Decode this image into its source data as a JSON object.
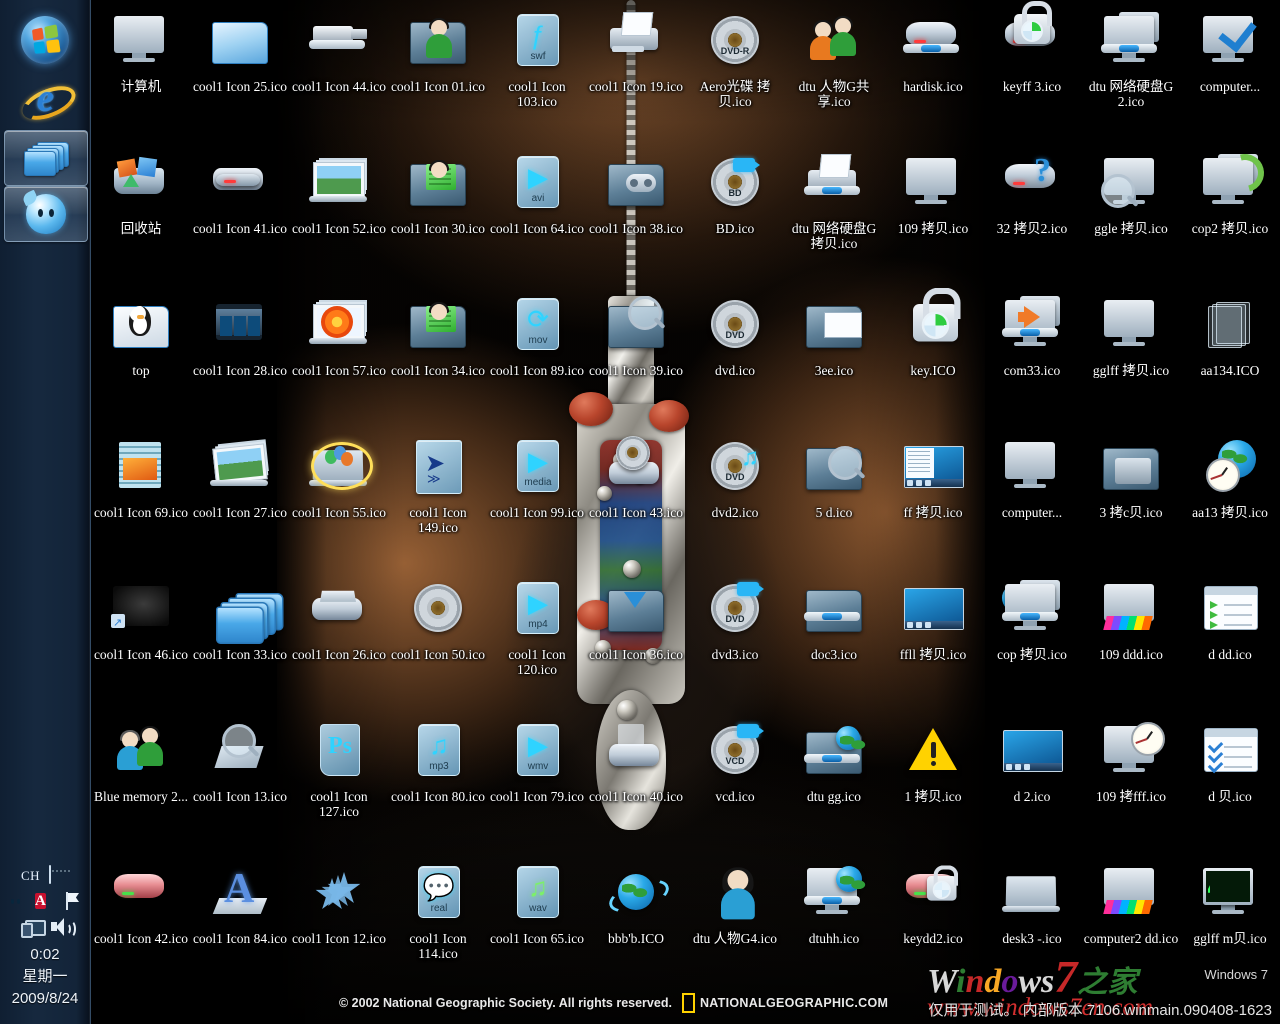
{
  "taskbar": {
    "start_button": "Start",
    "launchers": [
      {
        "name": "internet-explorer",
        "label": "Internet Explorer"
      },
      {
        "name": "windows-explorer",
        "label": "Windows Explorer"
      },
      {
        "name": "qq-messenger",
        "label": "QQ"
      }
    ],
    "tray": {
      "language": "CH",
      "keyboard": "keyboard-icon",
      "icons": [
        "qq-tray-icon",
        "avira-antivirus-icon",
        "action-flag-icon",
        "network-icon",
        "volume-icon"
      ],
      "clock_time": "0:02",
      "clock_weekday": "星期一",
      "clock_date": "2009/8/24"
    }
  },
  "watermark": {
    "brand_w": "W",
    "brand_i": "i",
    "brand_n": "n",
    "brand_d": "d",
    "brand_o": "o",
    "brand_ws": "ws",
    "brand_seven": "7",
    "brand_cn": "之家",
    "url": "www.windows7en.com",
    "product": "Windows 7",
    "build_notice": "仅用于测试。  内部版本 7106.winmain.090408-1623"
  },
  "wallpaper_credit": {
    "copyright": "© 2002 National Geographic Society. All rights reserved.",
    "brand": "NATIONALGEOGRAPHIC.COM"
  },
  "icons": [
    {
      "label": "计算机",
      "art": "computer"
    },
    {
      "label": "cool1 Icon 25.ico",
      "art": "folder-blue"
    },
    {
      "label": "cool1 Icon 44.ico",
      "art": "usb-drive"
    },
    {
      "label": "cool1 Icon 01.ico",
      "art": "person-green"
    },
    {
      "label": "cool1 Icon 103.ico",
      "art": "file-swf"
    },
    {
      "label": "cool1 Icon 19.ico",
      "art": "printer"
    },
    {
      "label": "Aero光碟 拷贝.ico",
      "art": "disc-dvdr"
    },
    {
      "label": "dtu 人物G共享.ico",
      "art": "two-people"
    },
    {
      "label": "hardisk.ico",
      "art": "harddisk"
    },
    {
      "label": "keyff 3.ico",
      "art": "disk-lock"
    },
    {
      "label": "dtu 网络硬盘G 2.ico",
      "art": "network-drive"
    },
    {
      "label": "computer...",
      "art": "monitor-check"
    },
    {
      "label": "回收站",
      "art": "recycle-bin"
    },
    {
      "label": "cool1 Icon 41.ico",
      "art": "scanner"
    },
    {
      "label": "cool1 Icon 52.ico",
      "art": "photo-laptop"
    },
    {
      "label": "cool1 Icon 30.ico",
      "art": "person-doc"
    },
    {
      "label": "cool1 Icon 64.ico",
      "art": "file-avi"
    },
    {
      "label": "cool1 Icon 38.ico",
      "art": "folder-game"
    },
    {
      "label": "BD.ico",
      "art": "disc-bd"
    },
    {
      "label": "dtu 网络硬盘G 拷贝.ico",
      "art": "printer-blue"
    },
    {
      "label": "109 拷贝.ico",
      "art": "monitor-plain"
    },
    {
      "label": "32 拷贝2.ico",
      "art": "disk-question"
    },
    {
      "label": "ggle 拷贝.ico",
      "art": "monitor-search"
    },
    {
      "label": "cop2 拷贝.ico",
      "art": "monitor-refresh"
    },
    {
      "label": "top",
      "art": "folder-penguin"
    },
    {
      "label": "cool1 Icon 28.ico",
      "art": "filmstrip"
    },
    {
      "label": "cool1 Icon 57.ico",
      "art": "photos-flower"
    },
    {
      "label": "cool1 Icon 34.ico",
      "art": "person-greendoc"
    },
    {
      "label": "cool1 Icon 89.ico",
      "art": "file-mov"
    },
    {
      "label": "cool1 Icon 39.ico",
      "art": "folder-search"
    },
    {
      "label": "dvd.ico",
      "art": "disc-dvd"
    },
    {
      "label": "3ee.ico",
      "art": "folder-mail"
    },
    {
      "label": "key.ICO",
      "art": "padlock"
    },
    {
      "label": "com33.ico",
      "art": "monitor-arrow"
    },
    {
      "label": "gglff 拷贝.ico",
      "art": "monitor-off"
    },
    {
      "label": "aa134.ICO",
      "art": "glass-sheets"
    },
    {
      "label": "cool1 Icon 69.ico",
      "art": "stack-docs"
    },
    {
      "label": "cool1 Icon 27.ico",
      "art": "photo-fan"
    },
    {
      "label": "cool1 Icon 55.ico",
      "art": "balloons"
    },
    {
      "label": "cool1 Icon 149.ico",
      "art": "swallow-doc"
    },
    {
      "label": "cool1 Icon 99.ico",
      "art": "file-media"
    },
    {
      "label": "cool1 Icon 43.ico",
      "art": "scanner-disc"
    },
    {
      "label": "dvd2.ico",
      "art": "disc-dvd-music"
    },
    {
      "label": "5 d.ico",
      "art": "folder-magnify"
    },
    {
      "label": "ff 拷贝.ico",
      "art": "start-menu"
    },
    {
      "label": "computer...",
      "art": "monitor-plain2"
    },
    {
      "label": "3 拷c贝.ico",
      "art": "folder-monitor"
    },
    {
      "label": "aa13 拷贝.ico",
      "art": "globe-clock"
    },
    {
      "label": "cool1 Icon 46.ico",
      "art": "dark-shortcut"
    },
    {
      "label": "cool1 Icon 33.ico",
      "art": "folder-stack"
    },
    {
      "label": "cool1 Icon 26.ico",
      "art": "scanner-open"
    },
    {
      "label": "cool1 Icon 50.ico",
      "art": "disc-plain"
    },
    {
      "label": "cool1 Icon 120.ico",
      "art": "file-mp4"
    },
    {
      "label": "cool1 Icon 36.ico",
      "art": "folder-download"
    },
    {
      "label": "dvd3.ico",
      "art": "disc-dvd-video"
    },
    {
      "label": "doc3.ico",
      "art": "folder-netdrive"
    },
    {
      "label": "ffll 拷贝.ico",
      "art": "desktop-shot"
    },
    {
      "label": "cop 拷贝.ico",
      "art": "globe-monitors"
    },
    {
      "label": "109 ddd.ico",
      "art": "monitor-rainbow"
    },
    {
      "label": "d dd.ico",
      "art": "list-arrows"
    },
    {
      "label": "Blue memory 2...",
      "art": "two-people2"
    },
    {
      "label": "cool1 Icon 13.ico",
      "art": "magnify-doc"
    },
    {
      "label": "cool1 Icon 127.ico",
      "art": "file-ps"
    },
    {
      "label": "cool1 Icon 80.ico",
      "art": "file-mp3"
    },
    {
      "label": "cool1 Icon 79.ico",
      "art": "file-wmv"
    },
    {
      "label": "cool1 Icon 40.ico",
      "art": "scanner-white"
    },
    {
      "label": "vcd.ico",
      "art": "disc-vcd"
    },
    {
      "label": "dtu gg.ico",
      "art": "folder-globe"
    },
    {
      "label": "1 拷贝.ico",
      "art": "warning"
    },
    {
      "label": "d 2.ico",
      "art": "desktop-shot2"
    },
    {
      "label": "109 拷fff.ico",
      "art": "monitor-clock"
    },
    {
      "label": "d 贝.ico",
      "art": "list-checks"
    },
    {
      "label": "cool1 Icon 42.ico",
      "art": "hdd-red"
    },
    {
      "label": "cool1 Icon 84.ico",
      "art": "letter-a"
    },
    {
      "label": "cool1 Icon 12.ico",
      "art": "stars"
    },
    {
      "label": "cool1 Icon 114.ico",
      "art": "file-real"
    },
    {
      "label": "cool1 Icon 65.ico",
      "art": "file-wav"
    },
    {
      "label": "bbb'b.ICO",
      "art": "globe-orbit"
    },
    {
      "label": "dtu 人物G4.ico",
      "art": "person-woman"
    },
    {
      "label": "dtuhh.ico",
      "art": "monitor-globe"
    },
    {
      "label": "keydd2.ico",
      "art": "hdd-red-lock"
    },
    {
      "label": "desk3 -.ico",
      "art": "laptop-desk"
    },
    {
      "label": "computer2 dd.ico",
      "art": "monitor-rainbow2"
    },
    {
      "label": "gglff m贝.ico",
      "art": "monitor-wave"
    }
  ]
}
